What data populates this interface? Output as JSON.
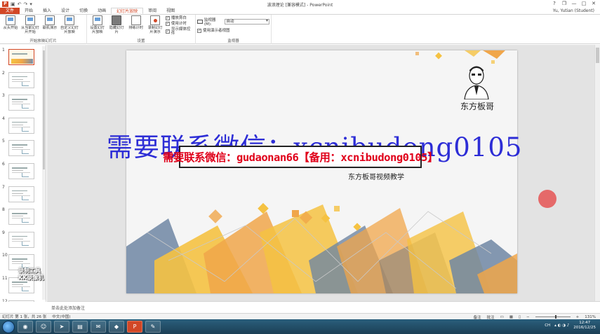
{
  "window": {
    "title": "波浪理论 [兼容模式] - PowerPoint",
    "user": "Yu, Yutian (Student)",
    "quick_access": [
      "save-icon",
      "undo-icon",
      "redo-icon",
      "customize-icon"
    ],
    "controls": {
      "help": "?",
      "restore": "❐",
      "minimize": "—",
      "maximize": "□",
      "close": "✕"
    }
  },
  "tabs": [
    {
      "label": "文件"
    },
    {
      "label": "开始"
    },
    {
      "label": "插入"
    },
    {
      "label": "设计"
    },
    {
      "label": "切换"
    },
    {
      "label": "动画"
    },
    {
      "label": "幻灯片放映"
    },
    {
      "label": "审阅"
    },
    {
      "label": "视图"
    }
  ],
  "ribbon": {
    "group_start": {
      "label": "开始放映幻灯片",
      "buttons": [
        {
          "label": "从头开始"
        },
        {
          "label": "从当前幻灯片开始"
        },
        {
          "label": "联机演示"
        },
        {
          "label": "自定义幻灯片放映"
        }
      ]
    },
    "group_setup": {
      "label": "设置",
      "buttons": [
        {
          "label": "设置幻灯片放映"
        },
        {
          "label": "隐藏幻灯片"
        },
        {
          "label": "排练计时"
        },
        {
          "label": "录制幻灯片演示"
        }
      ],
      "checks": [
        {
          "label": "播放旁白",
          "checked": "✓"
        },
        {
          "label": "使用计时",
          "checked": "✓"
        },
        {
          "label": "显示媒体控件",
          "checked": "✓"
        }
      ]
    },
    "group_monitor": {
      "label": "监视器",
      "monitor_label": "监视器(M):",
      "monitor_value": "自动",
      "presenter_view": "使用演示者视图",
      "presenter_checked": "✓"
    }
  },
  "thumbnails": [
    "1",
    "2",
    "3",
    "4",
    "5",
    "6",
    "7",
    "8",
    "9",
    "10",
    "11",
    "12"
  ],
  "slide": {
    "brand": "东方板哥",
    "subtitle": "东方板哥视频教学",
    "colors": {
      "yellow": "#f5c242",
      "orange": "#f0a64a",
      "blue": "#6f86a3",
      "gray": "#c9c9c9"
    }
  },
  "overlays": {
    "watermark_blue": "需要联系微信：xcnibudong0105",
    "watermark_red": "需要联系微信：gudaonan66【备用：xcnibudong0105】",
    "recorder_line1": "录制工具",
    "recorder_line2": "KK录像机"
  },
  "notes_placeholder": "单击此处添加备注",
  "status": {
    "slide_info": "幻灯片 第 1 张，共 26 张",
    "language": "中文(中国)",
    "notes_btn": "备注",
    "comments_btn": "批注",
    "zoom": "131%"
  },
  "taskbar": {
    "time": "12:47",
    "date": "2016/12/25",
    "lang": "CH"
  }
}
